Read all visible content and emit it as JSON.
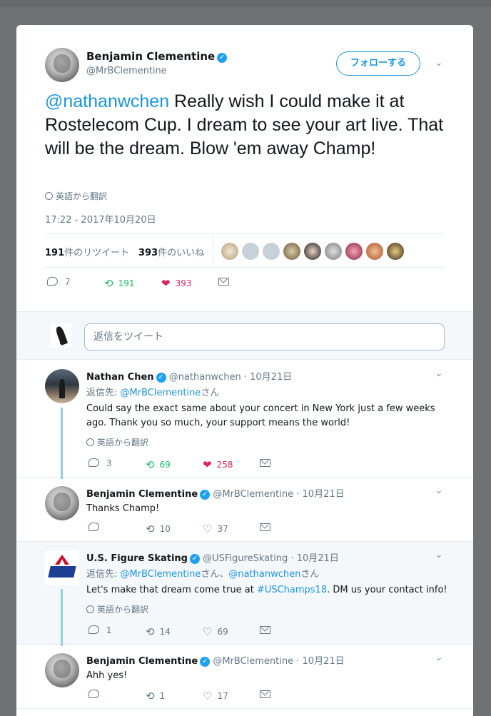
{
  "main_tweet": {
    "author_name": "Benjamin Clementine",
    "handle": "@MrBClementine",
    "follow_label": "フォローする",
    "mention": "@nathanwchen",
    "text": " Really wish I could make it at Rostelecom Cup. I dream to see your art live. That will be the dream. Blow 'em away Champ!",
    "translate_label": "英語から翻訳",
    "timestamp": "17:22 - 2017年10月20日",
    "retweets_count": "191",
    "retweets_label": "件のリツイート",
    "likes_count": "393",
    "likes_label": "件のいいね",
    "actions": {
      "replies": "7",
      "retweets": "191",
      "likes": "393"
    }
  },
  "reply_box": {
    "placeholder": "返信をツイート"
  },
  "replies": [
    {
      "author_name": "Nathan Chen",
      "handle": "@nathanwchen",
      "date": "10月21日",
      "reply_to_prefix": "返信先: ",
      "reply_to": "@MrBClementine",
      "reply_to_suffix": "さん",
      "text": "Could say the exact same about your concert in New York just a few weeks ago. Thank you so much, your support means the world!",
      "translate_label": "英語から翻訳",
      "actions": {
        "replies": "3",
        "retweets": "69",
        "likes": "258"
      }
    },
    {
      "author_name": "Benjamin Clementine",
      "handle": "@MrBClementine",
      "date": "10月21日",
      "text": "Thanks Champ!",
      "actions": {
        "replies": "",
        "retweets": "10",
        "likes": "37"
      }
    },
    {
      "author_name": "U.S. Figure Skating",
      "handle": "@USFigureSkating",
      "date": "10月21日",
      "reply_to_prefix": "返信先: ",
      "reply_to": "@MrBClementine",
      "reply_to_mid": "さん、",
      "reply_to_2": "@nathanwchen",
      "reply_to_suffix": "さん",
      "text_before": "Let's make that dream come true at ",
      "hashtag": "#USChamps18",
      "text_after": ". DM us your contact info!",
      "translate_label": "英語から翻訳",
      "actions": {
        "replies": "1",
        "retweets": "14",
        "likes": "69"
      }
    },
    {
      "author_name": "Benjamin Clementine",
      "handle": "@MrBClementine",
      "date": "10月21日",
      "text": "Ahh yes!",
      "actions": {
        "replies": "",
        "retweets": "1",
        "likes": "17"
      }
    }
  ],
  "separator": "·",
  "colors": {
    "link": "#1b95e0",
    "retweet": "#17bf63",
    "like": "#e0245e",
    "verified": "#1da1f2"
  }
}
